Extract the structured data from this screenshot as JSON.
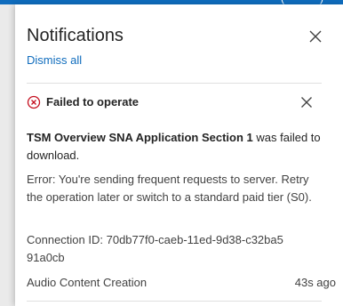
{
  "topbar": {
    "partial_text": "(··········)"
  },
  "panel": {
    "title": "Notifications",
    "dismiss_all_label": "Dismiss all",
    "close_icon": "close-icon"
  },
  "notification": {
    "status_icon": "error-circle-icon",
    "title": "Failed to operate",
    "item_name": "TSM Overview SNA Application Section 1",
    "message_suffix": "was failed to download.",
    "error_text": "Error: You're sending frequent requests to server. Retry the operation later or switch to a standard paid tier (S0).",
    "connection_id": "Connection ID: 70db77f0-caeb-11ed-9d38-c32ba591a0cb",
    "source": "Audio Content Creation",
    "time": "43s ago",
    "close_icon": "close-icon"
  },
  "colors": {
    "accent": "#0f6cbd",
    "error": "#c50f1f",
    "text": "#242424"
  }
}
